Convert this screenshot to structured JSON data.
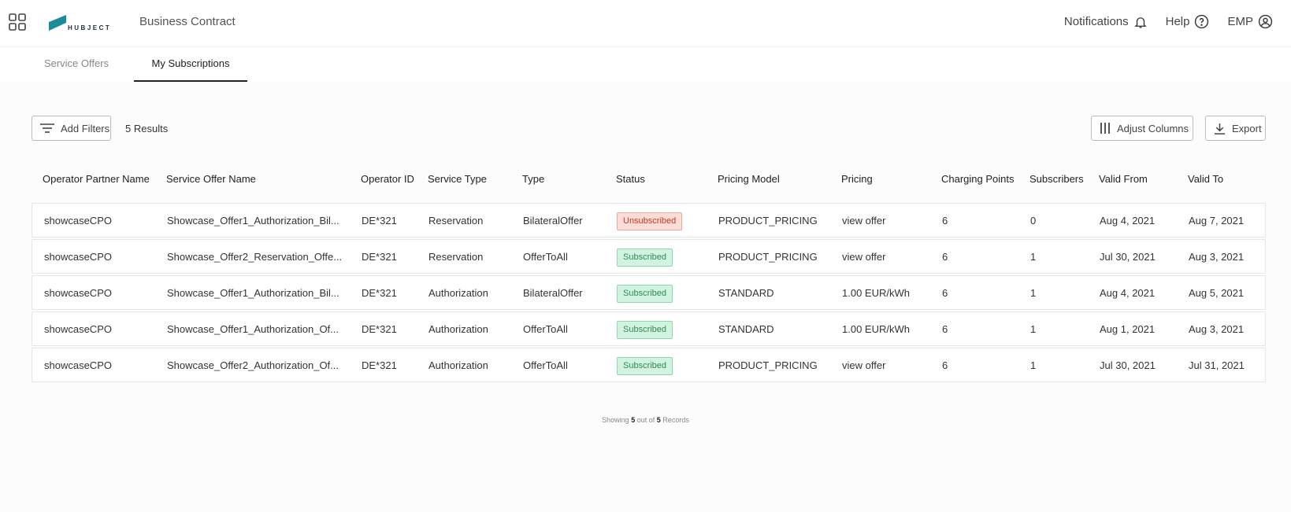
{
  "header": {
    "logo_text": "HUBJECT",
    "app_title": "Business Contract",
    "notifications": "Notifications",
    "help": "Help",
    "user": "EMP"
  },
  "tabs": [
    {
      "label": "Service Offers",
      "active": false
    },
    {
      "label": "My Subscriptions",
      "active": true
    }
  ],
  "toolbar": {
    "add_filters": "Add Filters",
    "results": "5 Results",
    "adjust_columns": "Adjust Columns",
    "export": "Export"
  },
  "table": {
    "columns": [
      "Operator Partner Name",
      "Service Offer Name",
      "Operator ID",
      "Service Type",
      "Type",
      "Status",
      "Pricing Model",
      "Pricing",
      "Charging Points",
      "Subscribers",
      "Valid From",
      "Valid To"
    ],
    "rows": [
      [
        "showcaseCPO",
        "Showcase_Offer1_Authorization_Bil...",
        "DE*321",
        "Reservation",
        "BilateralOffer",
        "Unsubscribed",
        "PRODUCT_PRICING",
        "view offer",
        "6",
        "0",
        "Aug 4, 2021",
        "Aug 7, 2021"
      ],
      [
        "showcaseCPO",
        "Showcase_Offer2_Reservation_Offe...",
        "DE*321",
        "Reservation",
        "OfferToAll",
        "Subscribed",
        "PRODUCT_PRICING",
        "view offer",
        "6",
        "1",
        "Jul 30, 2021",
        "Aug 3, 2021"
      ],
      [
        "showcaseCPO",
        "Showcase_Offer1_Authorization_Bil...",
        "DE*321",
        "Authorization",
        "BilateralOffer",
        "Subscribed",
        "STANDARD",
        "1.00 EUR/kWh",
        "6",
        "1",
        "Aug 4, 2021",
        "Aug 5, 2021"
      ],
      [
        "showcaseCPO",
        "Showcase_Offer1_Authorization_Of...",
        "DE*321",
        "Authorization",
        "OfferToAll",
        "Subscribed",
        "STANDARD",
        "1.00 EUR/kWh",
        "6",
        "1",
        "Aug 1, 2021",
        "Aug 3, 2021"
      ],
      [
        "showcaseCPO",
        "Showcase_Offer2_Authorization_Of...",
        "DE*321",
        "Authorization",
        "OfferToAll",
        "Subscribed",
        "PRODUCT_PRICING",
        "view offer",
        "6",
        "1",
        "Jul 30, 2021",
        "Jul 31, 2021"
      ]
    ]
  },
  "footer": {
    "prefix": "Showing",
    "shown": "5",
    "middle": "out of",
    "total": "5",
    "suffix": "Records"
  },
  "colors": {
    "brand": "#1b8a99",
    "unsubscribed": "#c0392b",
    "subscribed": "#2f8a55"
  }
}
